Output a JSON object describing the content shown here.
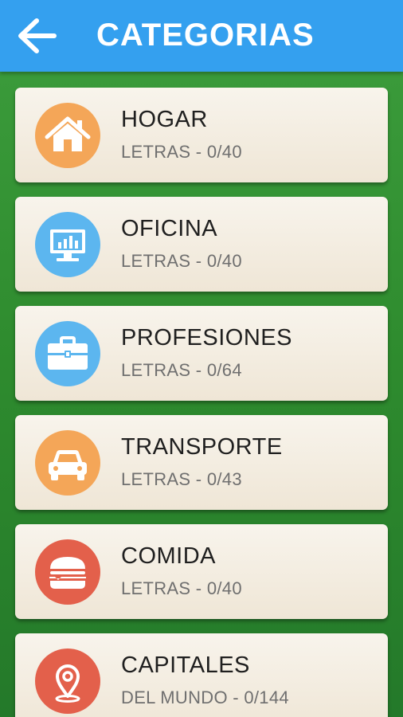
{
  "header": {
    "title": "CATEGORIAS",
    "back_icon": "arrow-left-icon",
    "background": "#34a0ef"
  },
  "categories": [
    {
      "title": "HOGAR",
      "subtitle": "LETRAS - 0/40",
      "icon": "house-icon",
      "color": "#f4a658"
    },
    {
      "title": "OFICINA",
      "subtitle": "LETRAS - 0/40",
      "icon": "computer-monitor-icon",
      "color": "#5cb6ef"
    },
    {
      "title": "PROFESIONES",
      "subtitle": "LETRAS - 0/64",
      "icon": "briefcase-icon",
      "color": "#5cb6ef"
    },
    {
      "title": "TRANSPORTE",
      "subtitle": "LETRAS - 0/43",
      "icon": "car-icon",
      "color": "#f4a658"
    },
    {
      "title": "COMIDA",
      "subtitle": "LETRAS - 0/40",
      "icon": "burger-icon",
      "color": "#e3604b"
    },
    {
      "title": "CAPITALES",
      "subtitle": "DEL MUNDO - 0/144",
      "icon": "map-pin-icon",
      "color": "#e3604b"
    }
  ]
}
